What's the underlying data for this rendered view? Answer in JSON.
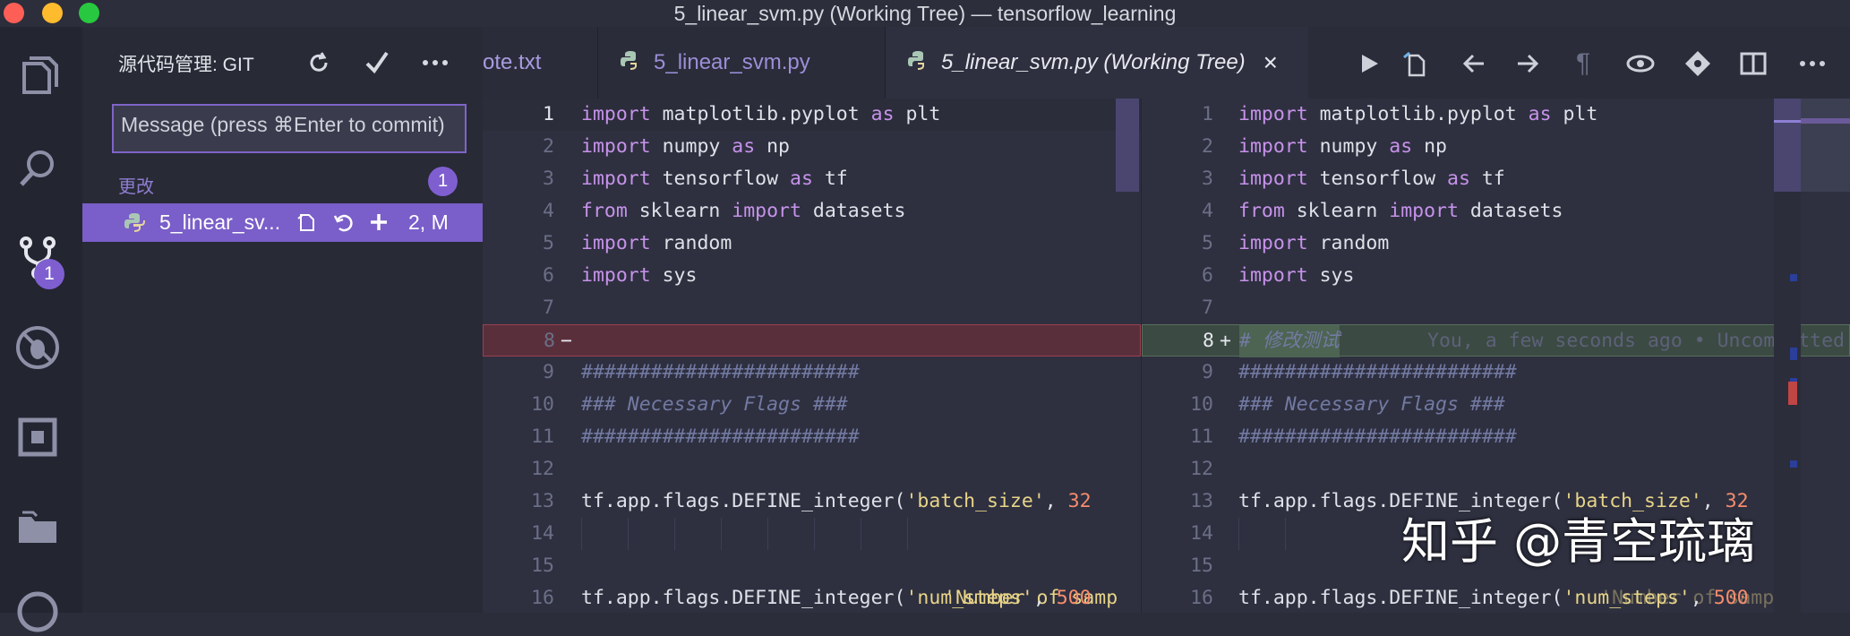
{
  "window": {
    "title": "5_linear_svm.py (Working Tree) — tensorflow_learning"
  },
  "activity_bar": {
    "scm_badge": "1"
  },
  "sidebar": {
    "title": "源代码管理: GIT",
    "message_placeholder": "Message (press ⌘Enter to commit)",
    "changes_label": "更改",
    "changes_count": "1",
    "file": {
      "name": "5_linear_sv...",
      "status": "2, M"
    }
  },
  "tabs": [
    {
      "label": "ote.txt"
    },
    {
      "label": "5_linear_svm.py"
    },
    {
      "label": "5_linear_svm.py (Working Tree)"
    }
  ],
  "editor": {
    "left_lines": [
      {
        "n": "1",
        "t": "import matplotlib.pyplot as plt"
      },
      {
        "n": "2",
        "t": "import numpy as np"
      },
      {
        "n": "3",
        "t": "import tensorflow as tf"
      },
      {
        "n": "4",
        "t": "from sklearn import datasets"
      },
      {
        "n": "5",
        "t": "import random"
      },
      {
        "n": "6",
        "t": "import sys"
      },
      {
        "n": "7",
        "t": ""
      },
      {
        "n": "8",
        "t": ""
      },
      {
        "n": "9",
        "t": "########################"
      },
      {
        "n": "10",
        "t": "### Necessary Flags ###"
      },
      {
        "n": "11",
        "t": "########################"
      },
      {
        "n": "12",
        "t": ""
      },
      {
        "n": "13",
        "t": "tf.app.flags.DEFINE_integer('batch_size', 32"
      },
      {
        "n": "14",
        "t": "'Number of samp"
      },
      {
        "n": "15",
        "t": ""
      },
      {
        "n": "16",
        "t": "tf.app.flags.DEFINE_integer('num_steps', 500"
      }
    ],
    "right_lines": [
      {
        "n": "8",
        "t": "# 修改测试"
      },
      {
        "n": "blame",
        "t": "You, a few seconds ago • Uncommitted changes"
      }
    ],
    "watermark": "知乎 @青空琉璃"
  }
}
